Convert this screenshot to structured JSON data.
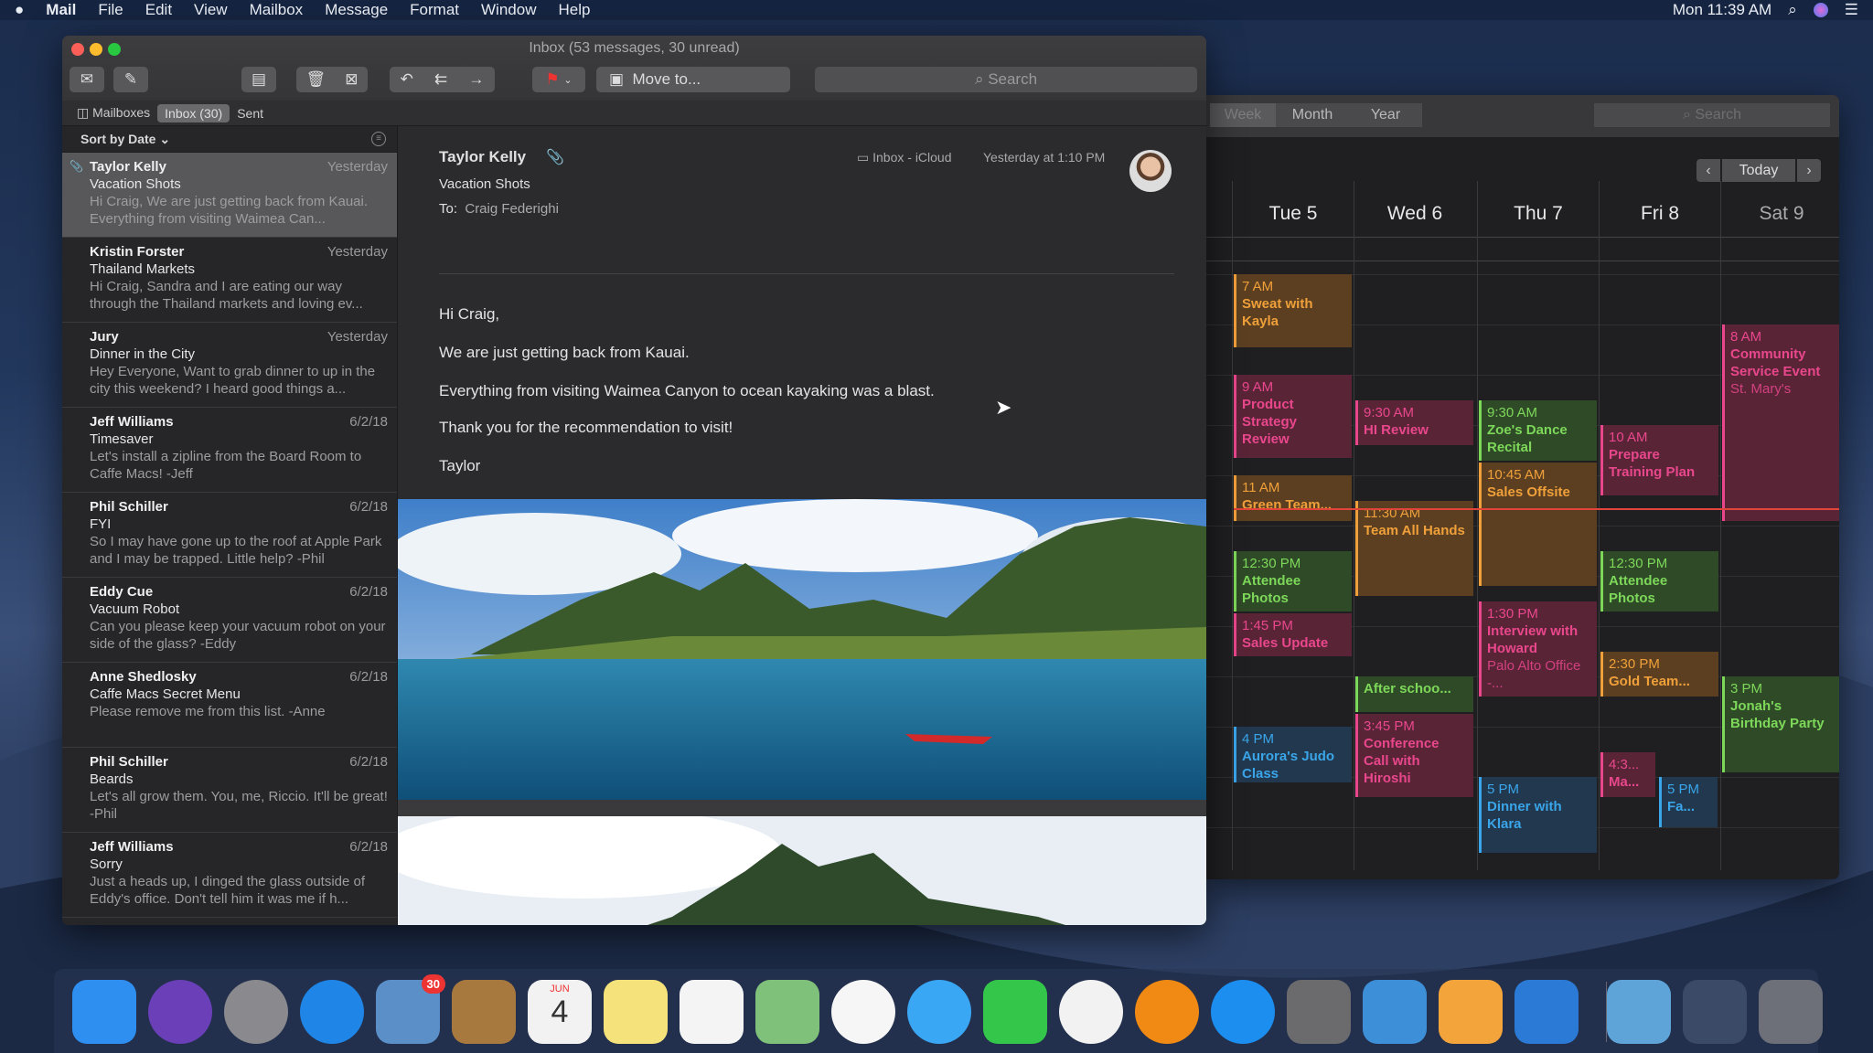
{
  "menubar": {
    "apple": "",
    "items": [
      "Mail",
      "File",
      "Edit",
      "View",
      "Mailbox",
      "Message",
      "Format",
      "Window",
      "Help"
    ],
    "clock": "Mon 11:39 AM"
  },
  "mail": {
    "title": "Inbox (53 messages, 30 unread)",
    "toolbar": {
      "move_to": "Move to...",
      "search_placeholder": "Search"
    },
    "tabs": {
      "mailboxes": "Mailboxes",
      "inbox": "Inbox (30)",
      "sent": "Sent"
    },
    "sort": "Sort by Date ⌄",
    "messages": [
      {
        "from": "Taylor Kelly",
        "date": "Yesterday",
        "subject": "Vacation Shots",
        "preview": "Hi Craig, We are just getting back from Kauai. Everything from visiting Waimea Can...",
        "selected": true,
        "attachment": true
      },
      {
        "from": "Kristin Forster",
        "date": "Yesterday",
        "subject": "Thailand Markets",
        "preview": "Hi Craig, Sandra and I are eating our way through the Thailand markets and loving ev..."
      },
      {
        "from": "Jury",
        "date": "Yesterday",
        "subject": "Dinner in the City",
        "preview": "Hey Everyone, Want to grab dinner to up in the city this weekend? I heard good things a..."
      },
      {
        "from": "Jeff Williams",
        "date": "6/2/18",
        "subject": "Timesaver",
        "preview": "Let's install a zipline from the Board Room to Caffe Macs! -Jeff"
      },
      {
        "from": "Phil Schiller",
        "date": "6/2/18",
        "subject": "FYI",
        "preview": "So I may have gone up to the roof at Apple Park and I may be trapped. Little help? -Phil"
      },
      {
        "from": "Eddy Cue",
        "date": "6/2/18",
        "subject": "Vacuum Robot",
        "preview": "Can you please keep your vacuum robot on your side of the glass? -Eddy"
      },
      {
        "from": "Anne Shedlosky",
        "date": "6/2/18",
        "subject": "Caffe Macs Secret Menu",
        "preview": "Please remove me from this list. -Anne"
      },
      {
        "from": "Phil Schiller",
        "date": "6/2/18",
        "subject": "Beards",
        "preview": "Let's all grow them. You, me, Riccio. It'll be great! -Phil"
      },
      {
        "from": "Jeff Williams",
        "date": "6/2/18",
        "subject": "Sorry",
        "preview": "Just a heads up, I dinged the glass outside of Eddy's office. Don't tell him it was me if h..."
      }
    ],
    "reader": {
      "from": "Taylor Kelly",
      "subject": "Vacation Shots",
      "to_label": "To:",
      "to": "Craig Federighi",
      "mailbox": "Inbox - iCloud",
      "time": "Yesterday at 1:10 PM",
      "body": [
        "Hi Craig,",
        "We are just getting back from Kauai.",
        "Everything from visiting Waimea Canyon to ocean kayaking was a blast.",
        "Thank you for the recommendation to visit!",
        "Taylor"
      ]
    }
  },
  "calendar": {
    "views": [
      "Week",
      "Month",
      "Year"
    ],
    "selected_view": "Week",
    "search_placeholder": "Search",
    "today": "Today",
    "days": [
      "Tue 5",
      "Wed 6",
      "Thu 7",
      "Fri 8",
      "Sat 9"
    ],
    "now_hour": 11.65,
    "colors": {
      "orange": "#f0a03a",
      "pink": "#e8478c",
      "green": "#7dd85a",
      "blue": "#3aa5e8"
    },
    "events": [
      {
        "day": 0,
        "start": 7,
        "end": 8.45,
        "color": "orange",
        "time": "7 AM",
        "title": "Sweat with Kayla"
      },
      {
        "day": 0,
        "start": 9,
        "end": 10.65,
        "color": "pink",
        "time": "9 AM",
        "title": "Product Strategy Review"
      },
      {
        "day": 0,
        "start": 11,
        "end": 11.9,
        "color": "orange",
        "time": "11 AM",
        "title": "Green Team..."
      },
      {
        "day": 0,
        "start": 12.5,
        "end": 13.7,
        "color": "green",
        "time": "12:30 PM",
        "title": "Attendee Photos"
      },
      {
        "day": 0,
        "start": 13.75,
        "end": 14.6,
        "color": "pink",
        "time": "1:45 PM",
        "title": "Sales Update"
      },
      {
        "day": 0,
        "start": 16,
        "end": 17.1,
        "color": "blue",
        "time": "4 PM",
        "title": "Aurora's Judo Class"
      },
      {
        "day": 1,
        "start": 9.5,
        "end": 10.4,
        "color": "pink",
        "time": "9:30 AM",
        "title": "HI Review"
      },
      {
        "day": 1,
        "start": 11.5,
        "end": 13.4,
        "color": "orange",
        "time": "11:30 AM",
        "title": "Team All Hands"
      },
      {
        "day": 1,
        "start": 15,
        "end": 15.7,
        "color": "green",
        "time": "",
        "title": "After schoo..."
      },
      {
        "day": 1,
        "start": 15.75,
        "end": 17.4,
        "color": "pink",
        "time": "3:45 PM",
        "title": "Conference Call with Hiroshi"
      },
      {
        "day": 2,
        "start": 9.5,
        "end": 10.7,
        "color": "green",
        "time": "9:30 AM",
        "title": "Zoe's Dance Recital"
      },
      {
        "day": 2,
        "start": 10.75,
        "end": 13.2,
        "color": "orange",
        "time": "10:45 AM",
        "title": "Sales Offsite"
      },
      {
        "day": 2,
        "start": 13.5,
        "end": 15.4,
        "color": "pink",
        "time": "1:30 PM",
        "title": "Interview with Howard",
        "location": "Palo Alto Office -..."
      },
      {
        "day": 2,
        "start": 17,
        "end": 18.5,
        "color": "blue",
        "time": "5 PM",
        "title": "Dinner with Klara"
      },
      {
        "day": 3,
        "start": 10,
        "end": 11.4,
        "color": "pink",
        "time": "10 AM",
        "title": "Prepare Training Plan"
      },
      {
        "day": 3,
        "start": 12.5,
        "end": 13.7,
        "color": "green",
        "time": "12:30 PM",
        "title": "Attendee Photos"
      },
      {
        "day": 3,
        "start": 14.5,
        "end": 15.4,
        "color": "orange",
        "time": "2:30 PM",
        "title": "Gold Team..."
      },
      {
        "day": 3,
        "start": 16.5,
        "end": 17.4,
        "color": "pink",
        "time": "4:3...",
        "title": "Ma...",
        "half": "left"
      },
      {
        "day": 3,
        "start": 17,
        "end": 18,
        "color": "blue",
        "time": "5 PM",
        "title": "Fa...",
        "half": "right"
      },
      {
        "day": 4,
        "start": 8,
        "end": 11.9,
        "color": "pink",
        "time": "8 AM",
        "title": "Community Service Event",
        "location": "St. Mary's"
      },
      {
        "day": 4,
        "start": 15,
        "end": 16.9,
        "color": "green",
        "time": "3 PM",
        "title": "Jonah's Birthday Party"
      }
    ]
  },
  "dock": {
    "apps": [
      {
        "name": "finder",
        "color": "#2f8ff0"
      },
      {
        "name": "siri",
        "color": "#6a3fb8"
      },
      {
        "name": "launchpad",
        "color": "#8a8a8e"
      },
      {
        "name": "safari",
        "color": "#1f86e8"
      },
      {
        "name": "mail",
        "color": "#5a8fc8",
        "badge": "30"
      },
      {
        "name": "contacts",
        "color": "#a8793e"
      },
      {
        "name": "calendar",
        "color": "#f2f2f2",
        "label": "4",
        "month": "JUN"
      },
      {
        "name": "notes",
        "color": "#f5e27a"
      },
      {
        "name": "reminders",
        "color": "#f4f4f4"
      },
      {
        "name": "maps",
        "color": "#7fc07a"
      },
      {
        "name": "photos",
        "color": "#f6f6f6"
      },
      {
        "name": "messages",
        "color": "#3aa7f5"
      },
      {
        "name": "facetime",
        "color": "#33c64a"
      },
      {
        "name": "itunes",
        "color": "#f2f2f2"
      },
      {
        "name": "books",
        "color": "#f08a14"
      },
      {
        "name": "app-store",
        "color": "#1c8ef0"
      },
      {
        "name": "system-preferences",
        "color": "#6b6b6e"
      },
      {
        "name": "keynote",
        "color": "#3d8fd8"
      },
      {
        "name": "pages",
        "color": "#f3a43a"
      },
      {
        "name": "xcode",
        "color": "#2b7bd6"
      },
      {
        "name": "downloads",
        "color": "#5fa4d8"
      },
      {
        "name": "screenshots",
        "color": "#3b4a66"
      },
      {
        "name": "trash",
        "color": "#6d7078"
      }
    ]
  }
}
